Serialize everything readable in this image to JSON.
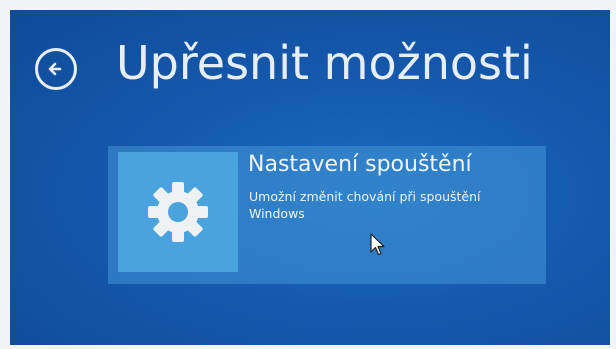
{
  "header": {
    "title": "Upřesnit možnosti",
    "back_icon": "back-arrow-circle-icon"
  },
  "options": [
    {
      "title": "Nastavení spouštění",
      "description": "Umožní změnit chování při spouštění Windows",
      "icon": "gear-icon"
    }
  ],
  "colors": {
    "background": "#1559ad",
    "tile_background": "#3b8fd0",
    "icon_box": "#4aa3dc",
    "text": "#e8eef8"
  }
}
